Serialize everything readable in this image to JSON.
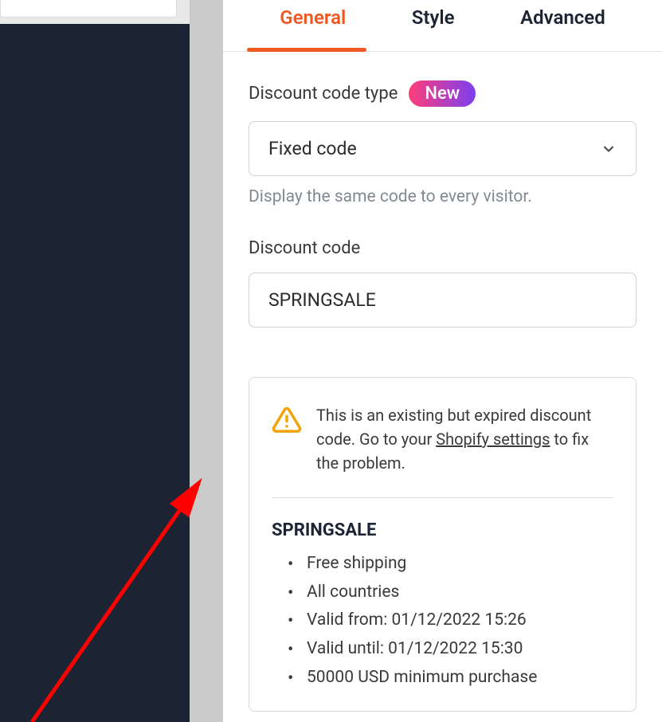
{
  "tabs": {
    "general": "General",
    "style": "Style",
    "advanced": "Advanced"
  },
  "discountType": {
    "label": "Discount code type",
    "badge": "New",
    "value": "Fixed code",
    "help": "Display the same code to every visitor."
  },
  "discountCode": {
    "label": "Discount code",
    "value": "SPRINGSALE"
  },
  "warning": {
    "text1": "This is an existing but expired discount code. Go to your ",
    "linkText": "Shopify settings",
    "text2": " to fix the problem."
  },
  "details": {
    "name": "SPRINGSALE",
    "items": [
      "Free shipping",
      "All countries",
      "Valid from: 01/12/2022 15:26",
      "Valid until: 01/12/2022 15:30",
      "50000 USD minimum purchase"
    ]
  }
}
